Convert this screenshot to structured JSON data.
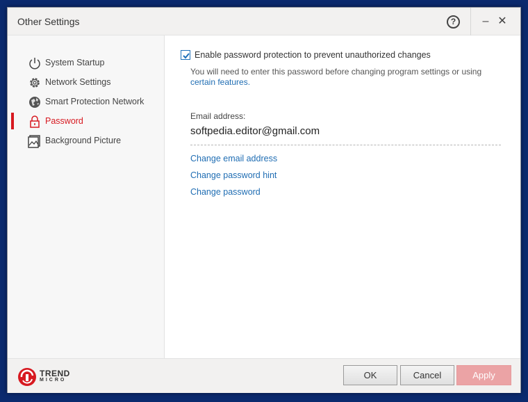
{
  "window": {
    "title": "Other Settings",
    "help_glyph": "?",
    "minimize_glyph": "–",
    "close_glyph": "✕"
  },
  "sidebar": {
    "items": [
      {
        "label": "System Startup",
        "icon": "power-icon",
        "active": false
      },
      {
        "label": "Network Settings",
        "icon": "gear-icon",
        "active": false
      },
      {
        "label": "Smart Protection Network",
        "icon": "globe-icon",
        "active": false
      },
      {
        "label": "Password",
        "icon": "lock-icon",
        "active": true
      },
      {
        "label": "Background Picture",
        "icon": "picture-icon",
        "active": false
      }
    ]
  },
  "password": {
    "enable_label": "Enable password protection to prevent unauthorized changes",
    "enable_checked": true,
    "note_text": "You will need to enter this password before changing program settings or using",
    "note_link": "certain features.",
    "email_label": "Email address:",
    "email_value": "softpedia.editor@gmail.com",
    "links": {
      "change_email": "Change email address",
      "change_hint": "Change password hint",
      "change_password": "Change password"
    }
  },
  "footer": {
    "logo_line1": "TREND",
    "logo_line2": "MICRO",
    "ok": "OK",
    "cancel": "Cancel",
    "apply": "Apply"
  },
  "colors": {
    "accent_red": "#d71920",
    "link_blue": "#1f6db3",
    "apply_disabled": "#eba3a5"
  }
}
